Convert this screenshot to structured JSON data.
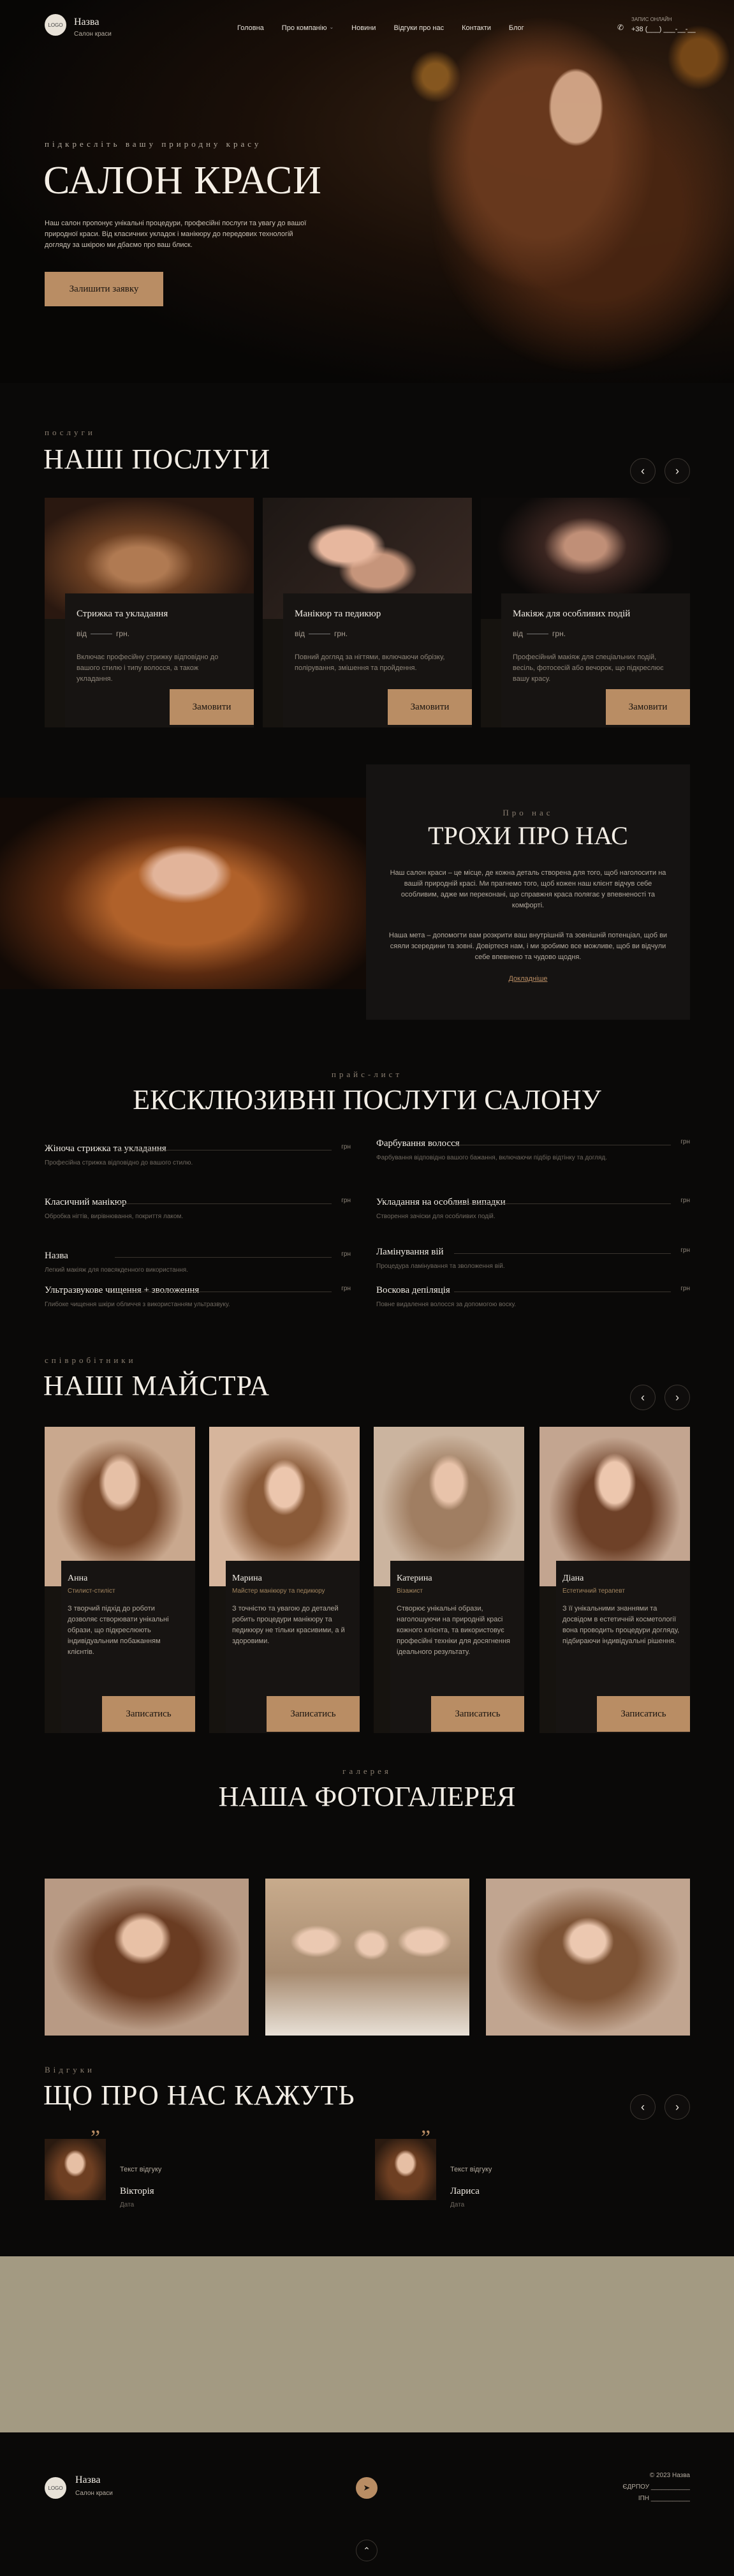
{
  "header": {
    "logo_text": "LOGO",
    "brand_name": "Назва",
    "brand_sub": "Салон краси",
    "nav": [
      "Головна",
      "Про компанію",
      "Новини",
      "Відгуки про нас",
      "Контакти",
      "Блог"
    ],
    "contact_label": "ЗАПИС ОНЛАЙН",
    "contact_phone": "+38 (___) ___-__-__"
  },
  "hero": {
    "kicker": "підкресліть вашу природну красу",
    "title": "САЛОН КРАСИ",
    "text": "Наш салон пропонує унікальні процедури, професійні послуги та увагу до вашої природної краси. Від класичних укладок і манікюру до передових технологій догляду за шкірою ми дбаємо про ваш блиск.",
    "button": "Залишити заявку"
  },
  "services": {
    "kicker": "послуги",
    "title": "НАШІ ПОСЛУГИ",
    "prev": "‹",
    "next": "›",
    "price_from": "від",
    "currency": "грн.",
    "items": [
      {
        "title": "Стрижка та укладання",
        "desc": "Включає професійну стрижку відповідно до вашого стилю і типу волосся, а також укладання.",
        "button": "Замовити"
      },
      {
        "title": "Манікюр та педикюр",
        "desc": "Повний догляд за нігтями, включаючи обрізку, полірування, змішення та пройдення.",
        "button": "Замовити"
      },
      {
        "title": "Макіяж для особливих подій",
        "desc": "Професійний макіяж для спеціальних подій, весіль, фотосесій або вечорок, що підкреслює вашу красу.",
        "button": "Замовити"
      }
    ]
  },
  "about": {
    "kicker": "Про нас",
    "title": "ТРОХИ ПРО НАС",
    "p1": "Наш салон краси – це місце, де кожна деталь створена для того, щоб наголосити на вашій природній красі. Ми прагнемо того, щоб кожен наш клієнт відчув себе особливим, адже ми переконані, що справжня краса полягає у впевненості та комфорті.",
    "p2": "Наша мета – допомогти вам розкрити ваш внутрішній та зовнішній потенціал, щоб ви сяяли зсередини та зовні. Довіртеся нам, і ми зробимо все можливе, щоб ви відчули себе впевнено та чудово щодня.",
    "link": "Докладніше"
  },
  "prices": {
    "kicker": "прайс-лист",
    "title": "ЕКСКЛЮЗИВНІ ПОСЛУГИ САЛОНУ",
    "currency": "грн",
    "left": [
      {
        "name": "Жіноча стрижка та укладання",
        "desc": "Професійна стрижка відповідно до вашого стилю."
      },
      {
        "name": "Класичний манікюр",
        "desc": "Обробка нігтів, вирівнювання, покриття лаком."
      },
      {
        "name": "Назва",
        "desc": "Легкий макіяж для повсякденного використання."
      },
      {
        "name": "Ультразвукове чищення + зволоження",
        "desc": "Глибоке чищення шкіри обличчя з використанням ультразвуку."
      }
    ],
    "right": [
      {
        "name": "Фарбування волосся",
        "desc": "Фарбування відповідно вашого бажання, включаючи підбір відтінку та догляд."
      },
      {
        "name": "Укладання на особливі випадки",
        "desc": "Створення зачіски для особливих подій."
      },
      {
        "name": "Ламінування вій",
        "desc": "Процедура ламінування та зволоження вій."
      },
      {
        "name": "Воскова депіляція",
        "desc": "Повне видалення волосся за допомогою воску."
      }
    ]
  },
  "masters": {
    "kicker": "співробітники",
    "title": "НАШІ МАЙСТРА",
    "prev": "‹",
    "next": "›",
    "items": [
      {
        "name": "Анна",
        "role": "Стилист-стиліст",
        "bio": "З творчий підхід до роботи дозволяє створювати унікальні образи, що підкреслюють індивідуальним побажанням клієнтів.",
        "button": "Записатись"
      },
      {
        "name": "Марина",
        "role": "Майстер манікюру та педикюру",
        "bio": "З точністю та увагою до деталей робить процедури манікюру та педикюру не тільки красивими, а й здоровими.",
        "button": "Записатись"
      },
      {
        "name": "Катерина",
        "role": "Візажист",
        "bio": "Створює унікальні образи, наголошуючи на природній красі кожного клієнта, та використовує професійні техніки для досягнення ідеального результату.",
        "button": "Записатись"
      },
      {
        "name": "Діана",
        "role": "Естетичний терапевт",
        "bio": "З її унікальними знаннями та досвідом в естетичній косметології вона проводить процедури догляду, підбираючи індивідуальні рішення.",
        "button": "Записатись"
      }
    ]
  },
  "gallery": {
    "kicker": "галерея",
    "title": "НАША ФОТОГАЛЕРЕЯ"
  },
  "reviews": {
    "kicker": "Відгуки",
    "title": "ЩО ПРО НАС КАЖУТЬ",
    "prev": "‹",
    "next": "›",
    "items": [
      {
        "text": "Текст відгуку",
        "name": "Вікторія",
        "date": "Дата"
      },
      {
        "text": "Текст відгуку",
        "name": "Лариса",
        "date": "Дата"
      }
    ]
  },
  "footer": {
    "logo_text": "LOGO",
    "brand_name": "Назва",
    "brand_sub": "Салон краси",
    "copyright": "© 2023 Назва",
    "edrpou": "ЄДРПОУ ___________",
    "ipn": "ІПН ___________",
    "up": "⌃"
  },
  "colors": {
    "accent": "#b98d64",
    "background": "#0a0908",
    "beige_band": "#a39a82"
  }
}
